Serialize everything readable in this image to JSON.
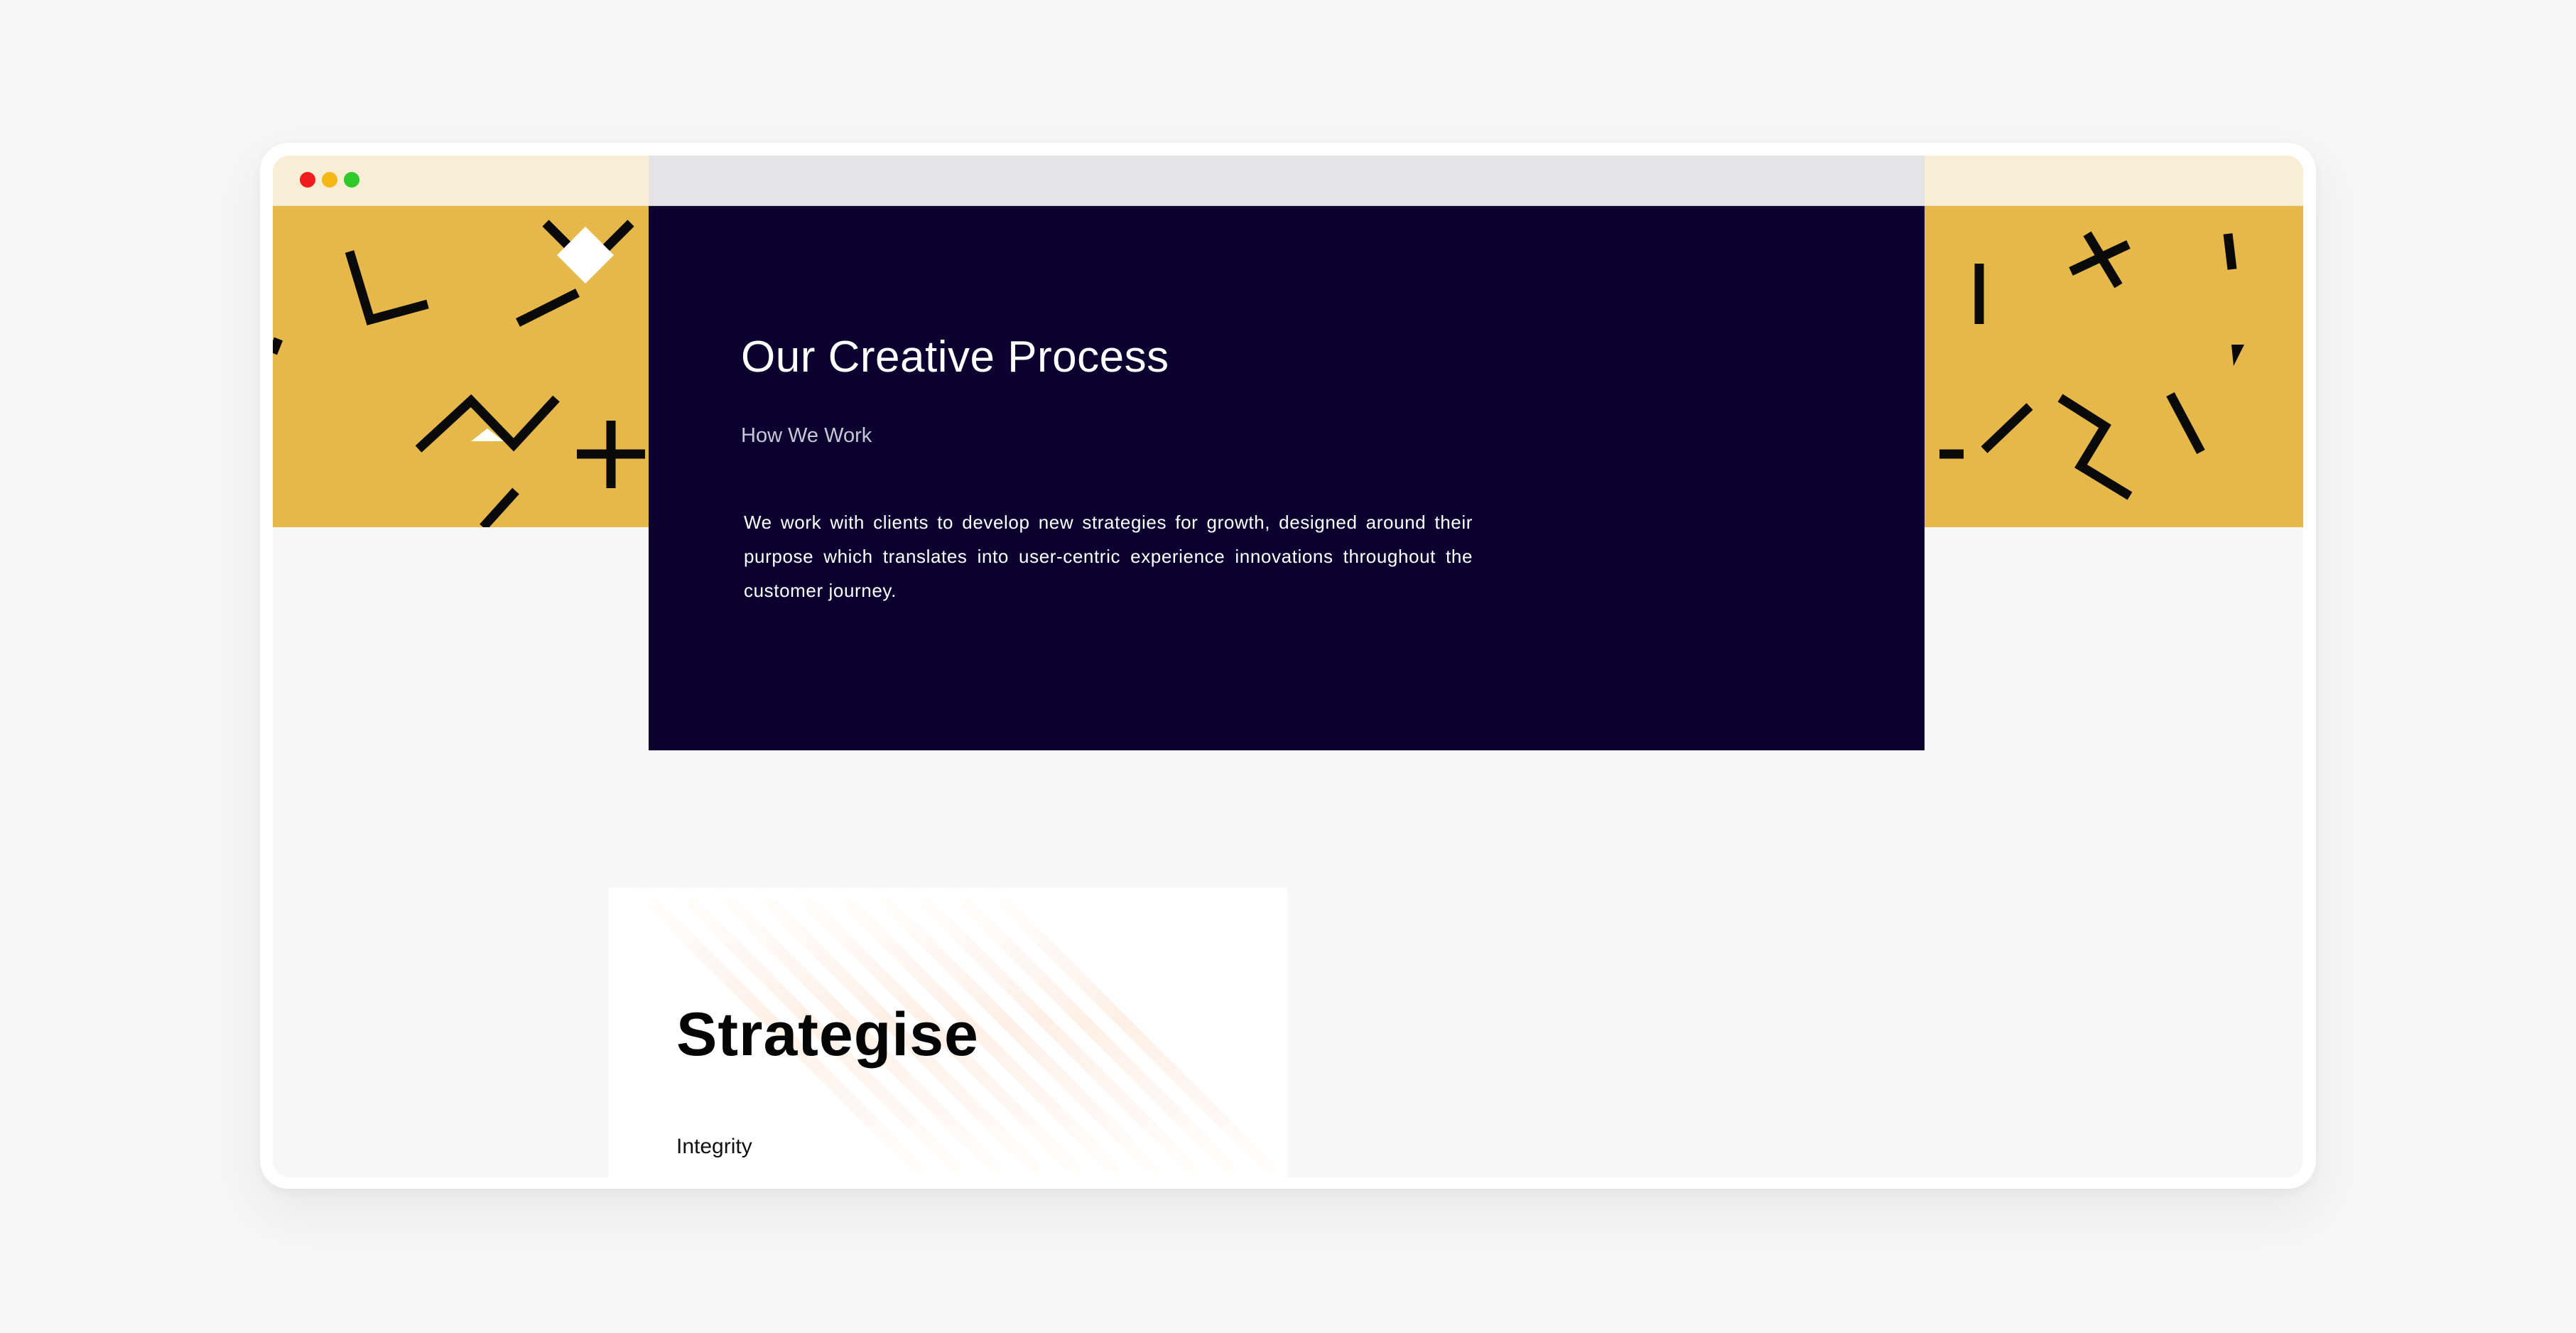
{
  "window": {
    "controls": [
      "close",
      "minimize",
      "maximize"
    ],
    "colors": {
      "close": "#ef1d1d",
      "minimize": "#f4b718",
      "maximize": "#2fc92a"
    }
  },
  "banner": {
    "background": "#e6b84a",
    "pattern": "scattered-black-geometric-strokes"
  },
  "hero": {
    "title": "Our Creative Process",
    "subtitle": "How We Work",
    "body": "We work with clients to develop new strategies for growth, designed around their purpose which translates into user-centric experience innovations throughout the customer journey.",
    "background": "#0c0230"
  },
  "card": {
    "title": "Strategise",
    "label": "Integrity"
  }
}
